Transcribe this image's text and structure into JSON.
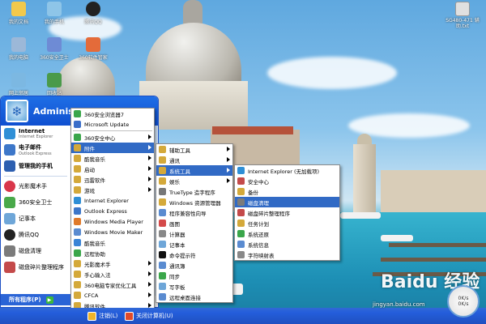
{
  "desktop_icons": [
    {
      "label": "我的文档",
      "color": "#f2c94c"
    },
    {
      "label": "我的手机",
      "color": "#8ec5e8"
    },
    {
      "label": "腾讯QQ",
      "color": "#222222"
    },
    {
      "label": "我的电脑",
      "color": "#9cb8d8"
    },
    {
      "label": "360安全卫士",
      "color": "#6e8bd5"
    },
    {
      "label": "360软件管家",
      "color": "#e46b3a"
    },
    {
      "label": "网上邻居",
      "color": "#7cb8e2"
    },
    {
      "label": "回收站",
      "color": "#4a9a4a"
    },
    {
      "label": "SG480-471 辅助.txt",
      "color": "#e0e0e0"
    }
  ],
  "start_menu": {
    "user_name": "Administ",
    "left_items": [
      {
        "label": "Internet",
        "sub": "Internet Explorer",
        "color": "#2f8fd6",
        "bold": true
      },
      {
        "label": "电子邮件",
        "sub": "Outlook Express",
        "color": "#3d77c9",
        "bold": true
      },
      {
        "label": "管理我的手机",
        "sub": "",
        "color": "#2d5fb0",
        "bold": true
      },
      {
        "label": "光影魔术手",
        "sub": "",
        "color": "#d9364a",
        "bold": false
      },
      {
        "label": "360安全卫士",
        "sub": "",
        "color": "#49a94a",
        "bold": false
      },
      {
        "label": "记事本",
        "sub": "",
        "color": "#6ea6d8",
        "bold": false
      },
      {
        "label": "腾讯QQ",
        "sub": "",
        "color": "#222222",
        "bold": false
      },
      {
        "label": "磁盘清理",
        "sub": "",
        "color": "#7b7b7b",
        "bold": false
      },
      {
        "label": "磁盘碎片整理程序",
        "sub": "",
        "color": "#c44a4a",
        "bold": false
      }
    ],
    "all_programs_label": "所有程序(P)",
    "logoff_label": "注销(L)",
    "shutdown_label": "关闭计算机(U)"
  },
  "programs_menu": [
    {
      "label": "360安全浏览器7",
      "color": "#3aa64a",
      "sub": false
    },
    {
      "label": "Microsoft Update",
      "color": "#3a6ec9",
      "sub": false
    },
    {
      "label": "360安全中心",
      "color": "#3aa64a",
      "sub": true
    },
    {
      "label": "附件",
      "color": "#d4a93a",
      "sub": true,
      "hl": true
    },
    {
      "label": "酷我音乐",
      "color": "#d4a93a",
      "sub": true
    },
    {
      "label": "启动",
      "color": "#d4a93a",
      "sub": true
    },
    {
      "label": "迅雷软件",
      "color": "#d4a93a",
      "sub": true
    },
    {
      "label": "游戏",
      "color": "#d4a93a",
      "sub": true
    },
    {
      "label": "Internet Explorer",
      "color": "#2f8fd6",
      "sub": false
    },
    {
      "label": "Outlook Express",
      "color": "#3d77c9",
      "sub": false
    },
    {
      "label": "Windows Media Player",
      "color": "#e07a2a",
      "sub": false
    },
    {
      "label": "Windows Movie Maker",
      "color": "#5a8bd0",
      "sub": false
    },
    {
      "label": "酷我音乐",
      "color": "#3a84d6",
      "sub": false
    },
    {
      "label": "远程协助",
      "color": "#3aa64a",
      "sub": false
    },
    {
      "label": "光影魔术手",
      "color": "#d4a93a",
      "sub": true
    },
    {
      "label": "手心输入法",
      "color": "#d4a93a",
      "sub": true
    },
    {
      "label": "360电脑专家优化工具",
      "color": "#d4a93a",
      "sub": true
    },
    {
      "label": "CFCA",
      "color": "#d4a93a",
      "sub": true
    },
    {
      "label": "腾讯软件",
      "color": "#d4a93a",
      "sub": true
    }
  ],
  "accessories_menu": [
    {
      "label": "辅助工具",
      "color": "#d4a93a",
      "sub": true
    },
    {
      "label": "通讯",
      "color": "#d4a93a",
      "sub": true
    },
    {
      "label": "系统工具",
      "color": "#d4a93a",
      "sub": true,
      "hl": true
    },
    {
      "label": "娱乐",
      "color": "#d4a93a",
      "sub": true
    },
    {
      "label": "TrueType 造字程序",
      "color": "#777777",
      "sub": false
    },
    {
      "label": "Windows 资源管理器",
      "color": "#d4a93a",
      "sub": false
    },
    {
      "label": "程序兼容性向导",
      "color": "#5a8bd0",
      "sub": false
    },
    {
      "label": "画图",
      "color": "#d44a4a",
      "sub": false
    },
    {
      "label": "计算器",
      "color": "#888888",
      "sub": false
    },
    {
      "label": "记事本",
      "color": "#6ea6d8",
      "sub": false
    },
    {
      "label": "命令提示符",
      "color": "#111111",
      "sub": false
    },
    {
      "label": "通讯簿",
      "color": "#5a8bd0",
      "sub": false
    },
    {
      "label": "同步",
      "color": "#3aa64a",
      "sub": false
    },
    {
      "label": "写字板",
      "color": "#6ea6d8",
      "sub": false
    },
    {
      "label": "远程桌面连接",
      "color": "#5a8bd0",
      "sub": false
    }
  ],
  "system_tools_menu": [
    {
      "label": "Internet Explorer (无加载项)",
      "color": "#2f8fd6",
      "hl": false
    },
    {
      "label": "安全中心",
      "color": "#c44a4a",
      "hl": false
    },
    {
      "label": "备份",
      "color": "#d4a93a",
      "hl": false
    },
    {
      "label": "磁盘清理",
      "color": "#7b7b7b",
      "hl": true
    },
    {
      "label": "磁盘碎片整理程序",
      "color": "#c44a4a",
      "hl": false
    },
    {
      "label": "任务计划",
      "color": "#d4a93a",
      "hl": false
    },
    {
      "label": "系统还原",
      "color": "#3aa64a",
      "hl": false
    },
    {
      "label": "系统信息",
      "color": "#5a8bd0",
      "hl": false
    },
    {
      "label": "字符映射表",
      "color": "#888888",
      "hl": false
    }
  ],
  "watermark": {
    "text": "Baidu 经验",
    "url": "jingyan.baidu.com"
  },
  "tray_badge": {
    "line1": "0K/s",
    "line2": "0K/s"
  }
}
